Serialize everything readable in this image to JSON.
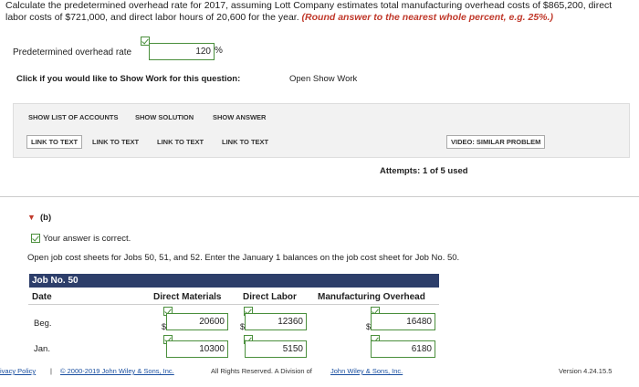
{
  "question": {
    "text": "Calculate the predetermined overhead rate for 2017, assuming Lott Company estimates total manufacturing overhead costs of $865,200, direct labor costs of $721,000, and direct labor hours of 20,600 for the year.",
    "instruction": "(Round answer to the nearest whole percent, e.g. 25%.)"
  },
  "rate": {
    "label": "Predetermined overhead rate",
    "value": "120",
    "unit": "%"
  },
  "show_work": {
    "prompt": "Click if you would like to Show Work for this question:",
    "link": "Open Show Work"
  },
  "buttons": {
    "show_list": "SHOW LIST OF ACCOUNTS",
    "show_solution": "SHOW SOLUTION",
    "show_answer": "SHOW ANSWER",
    "link1": "LINK TO TEXT",
    "link2": "LINK TO TEXT",
    "link3": "LINK TO TEXT",
    "link4": "LINK TO TEXT",
    "video": "VIDEO: SIMILAR PROBLEM"
  },
  "attempts": "Attempts: 1 of 5 used",
  "part_b": {
    "label": "(b)",
    "correct": "Your answer is correct.",
    "instructions": "Open job cost sheets for Jobs 50, 51, and 52. Enter the January 1 balances on the job cost sheet for Job No. 50."
  },
  "job_table": {
    "title": "Job No. 50",
    "headers": {
      "date": "Date",
      "dm": "Direct Materials",
      "dl": "Direct Labor",
      "mo": "Manufacturing Overhead"
    },
    "rows": [
      {
        "date": "Beg.",
        "dm": "20600",
        "dl": "12360",
        "mo": "16480"
      },
      {
        "date": "Jan.",
        "dm": "10300",
        "dl": "5150",
        "mo": "6180"
      }
    ],
    "currency": "$"
  },
  "footer": {
    "privacy": "ivacy Policy",
    "separator": "|",
    "copyright": "© 2000-2019 John Wiley & Sons, Inc.",
    "rights": "All Rights Reserved. A Division of",
    "company": "John Wiley & Sons, Inc.",
    "version": "Version 4.24.15.5"
  }
}
